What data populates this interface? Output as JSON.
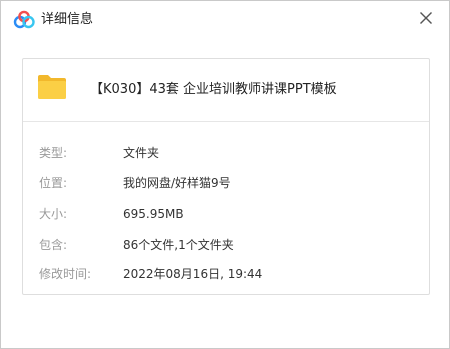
{
  "window": {
    "title": "详细信息",
    "icons": {
      "app": "baidu-netdisk-cloud-icon",
      "close": "close-icon",
      "file": "folder-icon"
    },
    "colors": {
      "folder": "#fbcf45",
      "folder_tab": "#f2b82c",
      "cloud_blue": "#2a8cf5",
      "cloud_red": "#f24e4e",
      "cloud_cyan": "#38c6f0"
    }
  },
  "file": {
    "name": "【K030】43套 企业培训教师讲课PPT模板"
  },
  "details": [
    {
      "label": "类型:",
      "value": "文件夹"
    },
    {
      "label": "位置:",
      "value": "我的网盘/好样猫9号"
    },
    {
      "label": "大小:",
      "value": "695.95MB"
    },
    {
      "label": "包含:",
      "value": "86个文件,1个文件夹"
    },
    {
      "label": "修改时间:",
      "value": "2022年08月16日, 19:44"
    }
  ]
}
